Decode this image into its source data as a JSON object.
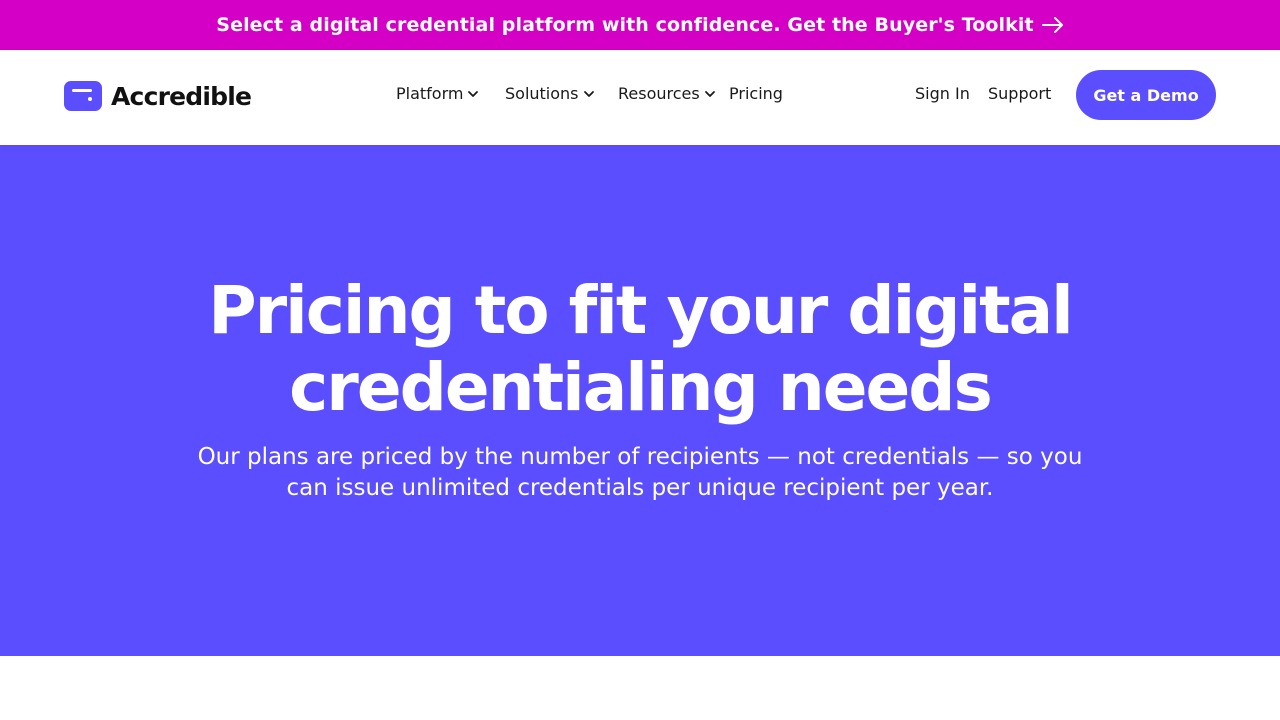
{
  "announcement": {
    "text": "Select a digital credential platform with confidence. Get the Buyer's Toolkit",
    "icon": "arrow-right-icon"
  },
  "header": {
    "logo_text": "Accredible",
    "logo_icon": "accredible-logo-icon",
    "menu": [
      {
        "label": "Platform",
        "has_dropdown": true
      },
      {
        "label": "Solutions",
        "has_dropdown": true
      },
      {
        "label": "Resources",
        "has_dropdown": true
      },
      {
        "label": "Pricing",
        "has_dropdown": false
      }
    ],
    "sign_in": "Sign In",
    "support": "Support",
    "cta": "Get a Demo"
  },
  "hero": {
    "title_line1": "Pricing to fit your digital",
    "title_line2": "credentialing needs",
    "subtitle_line1": "Our plans are priced by the number of recipients — not credentials — so you",
    "subtitle_line2": "can issue unlimited credentials per unique recipient per year."
  },
  "colors": {
    "announcement_bg": "#d400c5",
    "brand": "#5b4efe",
    "text_dark": "#1a1a1a",
    "white": "#ffffff"
  }
}
